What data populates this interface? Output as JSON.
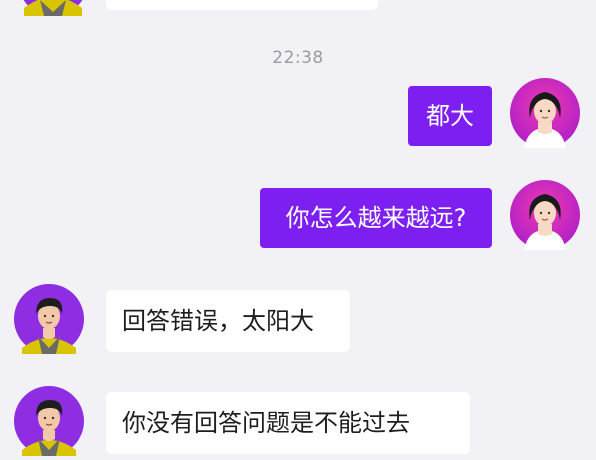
{
  "chat": {
    "timestamp": "22:38",
    "messages": [
      {
        "side": "out",
        "text": "都大"
      },
      {
        "side": "out",
        "text": "你怎么越来越远?"
      },
      {
        "side": "in",
        "text": "回答错误，太阳大"
      },
      {
        "side": "in",
        "text": "你没有回答问题是不能过去"
      }
    ],
    "avatars": {
      "user": "female-avatar-icon",
      "bot": "male-avatar-icon"
    },
    "colors": {
      "outgoing_bubble": "#7d1ff0",
      "incoming_bubble": "#ffffff",
      "background": "#f2f2f6"
    }
  }
}
